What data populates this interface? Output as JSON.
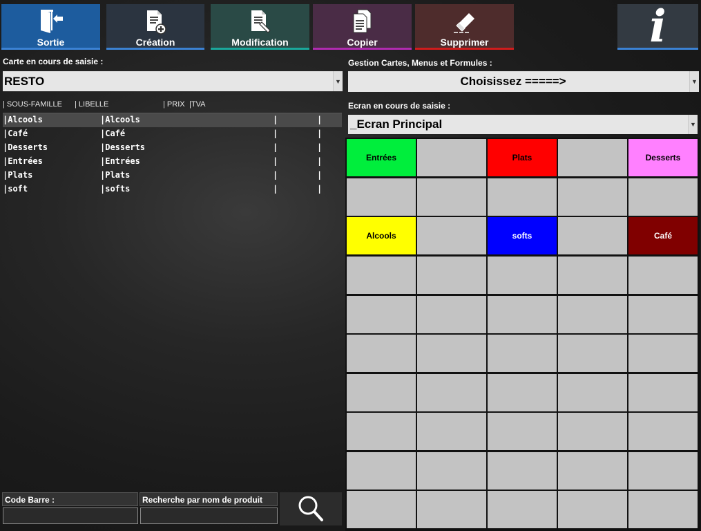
{
  "toolbar": {
    "sortie": {
      "label": "Sortie",
      "bg": "#1d5c9e",
      "line": "#3b82d4"
    },
    "creation": {
      "label": "Création",
      "bg": "#2b3440",
      "line": "#3b82d4"
    },
    "modification": {
      "label": "Modification",
      "bg": "#2a4a46",
      "line": "#1aa89c"
    },
    "copier": {
      "label": "Copier",
      "bg": "#4a2c46",
      "line": "#b02bb0"
    },
    "supprimer": {
      "label": "Supprimer",
      "bg": "#4e2c2c",
      "line": "#d01c1c"
    },
    "info": {
      "label": "i",
      "bg": "#333a42",
      "line": "#3b82d4"
    }
  },
  "left": {
    "carte_label": "Carte en cours de saisie :",
    "carte_value": "RESTO",
    "columns": [
      "| SOUS-FAMILLE",
      "| LIBELLE",
      "| PRIX",
      "|TVA"
    ],
    "rows": [
      {
        "sous_famille": "|Alcools",
        "libelle": "|Alcools",
        "prix": "|",
        "tva": "|"
      },
      {
        "sous_famille": "|Café",
        "libelle": "|Café",
        "prix": "|",
        "tva": "|"
      },
      {
        "sous_famille": "|Desserts",
        "libelle": "|Desserts",
        "prix": "|",
        "tva": "|"
      },
      {
        "sous_famille": "|Entrées",
        "libelle": "|Entrées",
        "prix": "|",
        "tva": "|"
      },
      {
        "sous_famille": "|Plats",
        "libelle": "|Plats",
        "prix": "|",
        "tva": "|"
      },
      {
        "sous_famille": "|soft",
        "libelle": "|softs",
        "prix": "|",
        "tva": "|"
      }
    ],
    "code_barre_label": "Code Barre :",
    "recherche_label": "Recherche par nom de produit",
    "code_barre_value": "",
    "recherche_value": ""
  },
  "right": {
    "gestion_label": "Gestion Cartes, Menus et Formules  :",
    "gestion_value": "Choisissez  =====>",
    "ecran_label": "Ecran en cours de saisie :",
    "ecran_value": "_Ecran Principal",
    "grid_rows": 10,
    "grid_cols": 5,
    "buttons": [
      {
        "row": 0,
        "col": 0,
        "label": "Entrées",
        "color": "#00ee3c"
      },
      {
        "row": 0,
        "col": 2,
        "label": "Plats",
        "color": "#ff0000"
      },
      {
        "row": 0,
        "col": 4,
        "label": "Desserts",
        "color": "#ff80ff"
      },
      {
        "row": 2,
        "col": 0,
        "label": "Alcools",
        "color": "#ffff00"
      },
      {
        "row": 2,
        "col": 2,
        "label": "softs",
        "color": "#0000ff"
      },
      {
        "row": 2,
        "col": 4,
        "label": "Café",
        "color": "#800000"
      }
    ]
  }
}
